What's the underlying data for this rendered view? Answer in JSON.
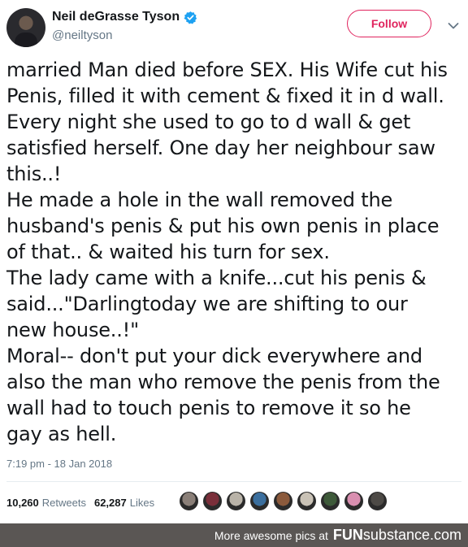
{
  "user": {
    "display_name": "Neil deGrasse Tyson",
    "handle": "@neiltyson",
    "verified": true
  },
  "actions": {
    "follow_label": "Follow"
  },
  "tweet": {
    "lines": [
      "married Man died before SEX. His Wife cut his",
      "Penis, filled it with cement & fixed it in d wall.",
      "Every night she used to go to d wall & get",
      "satisfied herself. One day her neighbour saw",
      "this..!",
      "He made a hole in the wall removed the",
      "husband's penis & put his own penis in place",
      "of that.. & waited his turn for sex.",
      "The lady came with a knife...cut his penis &",
      "said...\"Darlingtoday we are shifting to our",
      "new house..!\"",
      "Moral-- don't put your dick everywhere and",
      "also the man who remove the penis from the",
      "wall had to touch penis to remove it so he",
      "gay as hell."
    ],
    "timestamp": "7:19 pm - 18 Jan 2018"
  },
  "stats": {
    "retweets_count": "10,260",
    "retweets_label": "Retweets",
    "likes_count": "62,287",
    "likes_label": "Likes"
  },
  "liker_avatar_colors": [
    "#8a7f78",
    "#7a2f3a",
    "#b9b3a8",
    "#3b6f9e",
    "#8b5a3c",
    "#c9c2b6",
    "#3e5a3a",
    "#d98fb0",
    "#4d4a46"
  ],
  "footer": {
    "text": "More awesome pics at",
    "brand_bold": "FUN",
    "brand_thin": "substance",
    "brand_suffix": ".com"
  },
  "colors": {
    "accent": "#e0245e",
    "verified": "#1da1f2",
    "muted": "#657786",
    "footer_bg": "#5a5654"
  }
}
